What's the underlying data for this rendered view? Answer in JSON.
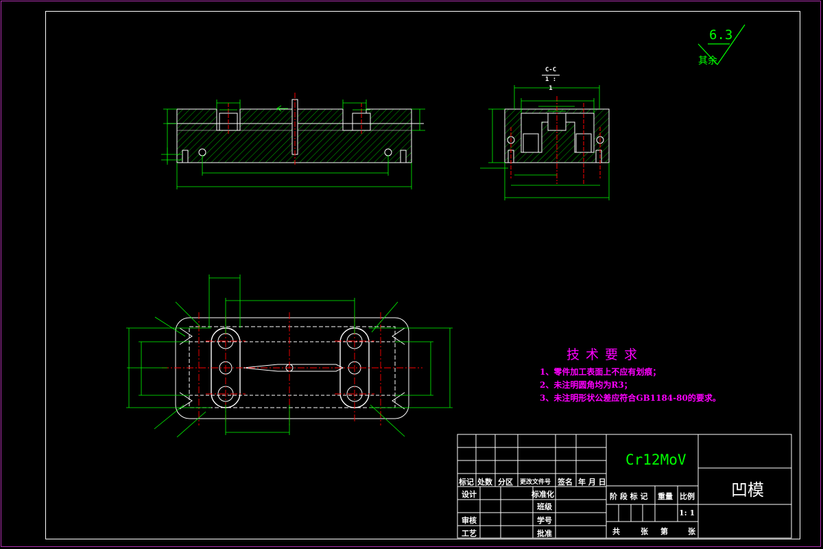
{
  "roughness": {
    "value": "6.3",
    "rest_label": "其余"
  },
  "section_view": {
    "name": "C-C",
    "scale": "1 : 1"
  },
  "tech_requirements": {
    "title": "技术要求",
    "items": [
      "1、零件加工表面上不应有划痕；",
      "2、未注明圆角均为R3；",
      "3、未注明形状公差应符合GB1184-80的要求。"
    ]
  },
  "title_block": {
    "material": "Cr12MoV",
    "part_name": "凹模",
    "revision_headers": [
      "标记",
      "处数",
      "分区",
      "更改文件号",
      "签名",
      "年 月 日"
    ],
    "design": "设计",
    "standardization": "标准化",
    "review": "审核",
    "process": "工艺",
    "class": "班级",
    "student_id": "学号",
    "approve": "批准",
    "stage_label": "阶 段 标 记",
    "weight_label": "重量",
    "scale_label": "比例",
    "scale_value": "1: 1",
    "sheets_total": "共",
    "sheets_unit1": "张",
    "sheet_no": "第",
    "sheets_unit2": "张"
  },
  "colors": {
    "background": "#000000",
    "frame": "#ffffff",
    "border": "#b030b0",
    "geometry": "#ffffff",
    "dimension": "#00ff00",
    "centerline": "#ff0000",
    "hatch": "#00ff00",
    "notes": "#ff00ff"
  }
}
